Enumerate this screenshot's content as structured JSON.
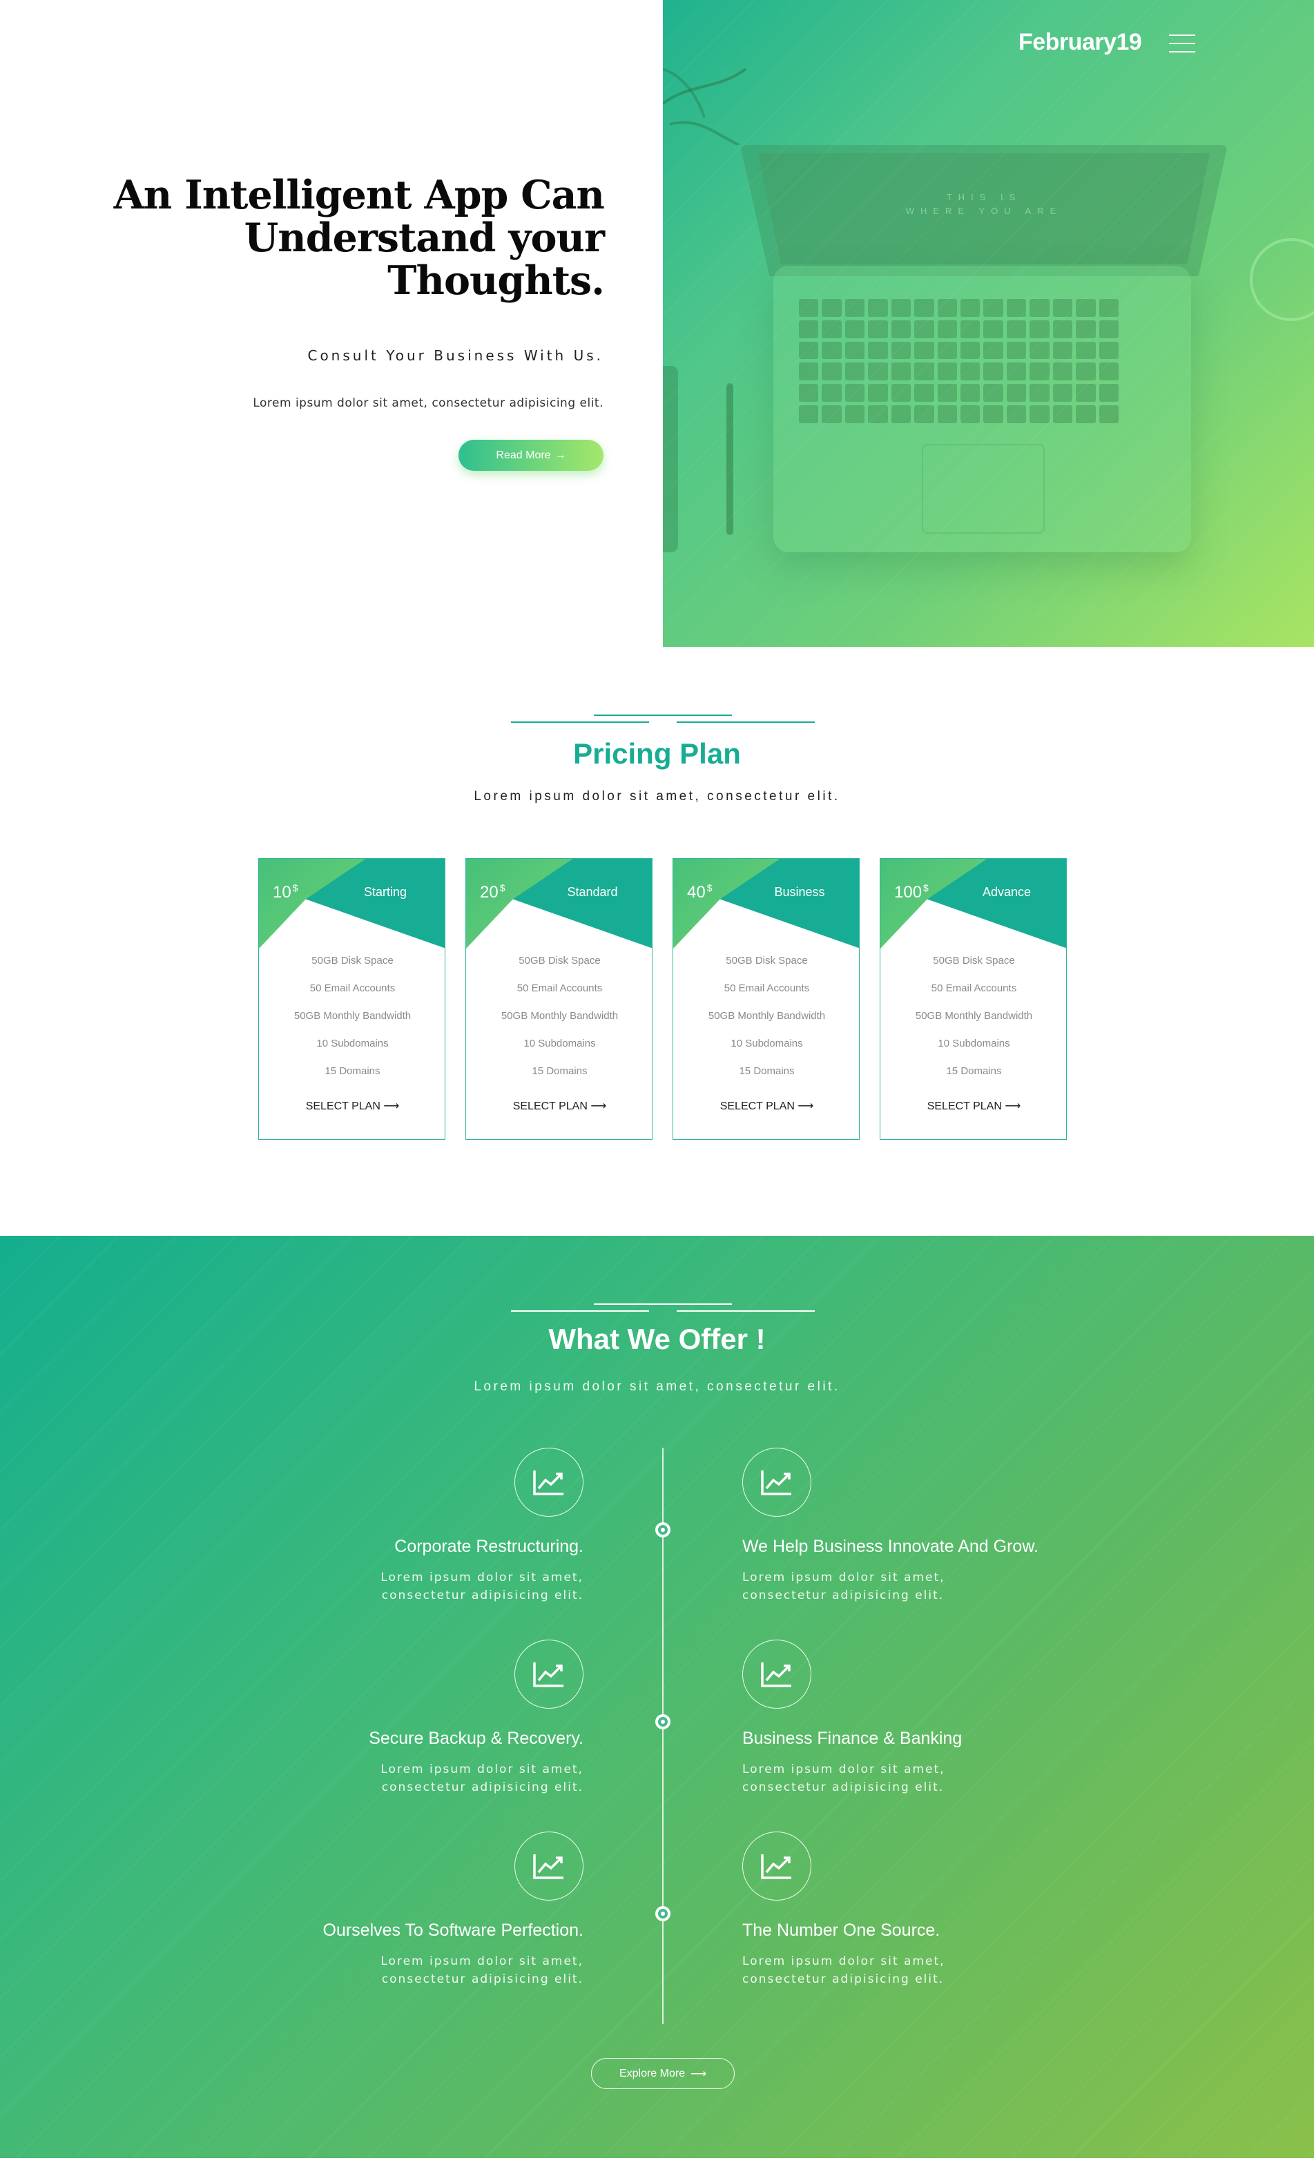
{
  "header": {
    "brand": "February19",
    "menu_icon": "hamburger-menu-icon"
  },
  "hero": {
    "title_lines": [
      "An Intelligent App Can",
      "Understand your",
      "Thoughts."
    ],
    "subtitle": "Consult Your Business With Us.",
    "text": "Lorem ipsum dolor sit amet, consectetur adipisicing elit.",
    "button_label": "Read More",
    "button_arrow": "→",
    "screen_line1": "THIS IS",
    "screen_line2": "WHERE YOU ARE"
  },
  "pricing": {
    "title": "Pricing Plan",
    "subtitle": "Lorem ipsum dolor sit amet, consectetur elit.",
    "select_label": "SELECT PLAN",
    "arrow": "⟶",
    "plans": [
      {
        "price": "10",
        "currency": "$",
        "name": "Starting",
        "features": [
          "50GB Disk Space",
          "50 Email Accounts",
          "50GB Monthly Bandwidth",
          "10 Subdomains",
          "15 Domains"
        ]
      },
      {
        "price": "20",
        "currency": "$",
        "name": "Standard",
        "features": [
          "50GB Disk Space",
          "50 Email Accounts",
          "50GB Monthly Bandwidth",
          "10 Subdomains",
          "15 Domains"
        ]
      },
      {
        "price": "40",
        "currency": "$",
        "name": "Business",
        "features": [
          "50GB Disk Space",
          "50 Email Accounts",
          "50GB Monthly Bandwidth",
          "10 Subdomains",
          "15 Domains"
        ]
      },
      {
        "price": "100",
        "currency": "$",
        "name": "Advance",
        "features": [
          "50GB Disk Space",
          "50 Email Accounts",
          "50GB Monthly Bandwidth",
          "10 Subdomains",
          "15 Domains"
        ]
      }
    ]
  },
  "offer": {
    "title": "What We Offer !",
    "subtitle": "Lorem ipsum dolor sit amet, consectetur elit.",
    "items": [
      {
        "title": "Corporate Restructuring.",
        "text": "Lorem ipsum dolor sit amet, consectetur adipisicing elit.",
        "icon": "chart-trend-icon"
      },
      {
        "title": "We Help Business Innovate And Grow.",
        "text": "Lorem ipsum dolor sit amet, consectetur adipisicing elit.",
        "icon": "chart-trend-icon"
      },
      {
        "title": "Secure Backup & Recovery.",
        "text": "Lorem ipsum dolor sit amet, consectetur adipisicing elit.",
        "icon": "chart-trend-icon"
      },
      {
        "title": "Business Finance & Banking",
        "text": "Lorem ipsum dolor sit amet, consectetur adipisicing elit.",
        "icon": "chart-trend-icon"
      },
      {
        "title": "Ourselves To Software Perfection.",
        "text": "Lorem ipsum dolor sit amet, consectetur adipisicing elit.",
        "icon": "chart-trend-icon"
      },
      {
        "title": "The Number One Source.",
        "text": "Lorem ipsum dolor sit amet, consectetur adipisicing elit.",
        "icon": "chart-trend-icon"
      }
    ],
    "button_label": "Explore More",
    "button_arrow": "⟶"
  },
  "colors": {
    "teal": "#16ad94",
    "green_light": "#a8e463",
    "title_teal": "#16ad94",
    "text_dark": "#222222"
  }
}
